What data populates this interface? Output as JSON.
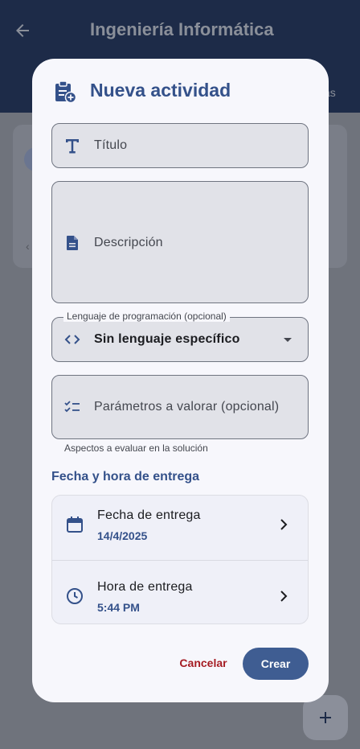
{
  "background": {
    "app_title": "Ingeniería Informática",
    "tab_fragment": "cas"
  },
  "dialog": {
    "title": "Nueva actividad",
    "title_field": {
      "placeholder": "Título",
      "icon": "text-fields-icon"
    },
    "description_field": {
      "placeholder": "Descripción",
      "icon": "description-icon"
    },
    "language_field": {
      "label": "Lenguaje de programación (opcional)",
      "value": "Sin lenguaje específico",
      "icon": "code-icon"
    },
    "params_field": {
      "placeholder": "Parámetros a valorar (opcional)",
      "helper": "Aspectos a evaluar en la solución",
      "icon": "checklist-icon"
    },
    "due_section_title": "Fecha y hora de entrega",
    "due_date": {
      "label": "Fecha de entrega",
      "value": "14/4/2025",
      "icon": "calendar-icon"
    },
    "due_time": {
      "label": "Hora de entrega",
      "value": "5:44 PM",
      "icon": "clock-icon"
    },
    "actions": {
      "cancel": "Cancelar",
      "create": "Crear"
    }
  },
  "colors": {
    "primary": "#34518a",
    "button": "#3f5d92",
    "cancel": "#a51c23",
    "surface": "#f7f7fc",
    "field": "#e1e2e8"
  }
}
